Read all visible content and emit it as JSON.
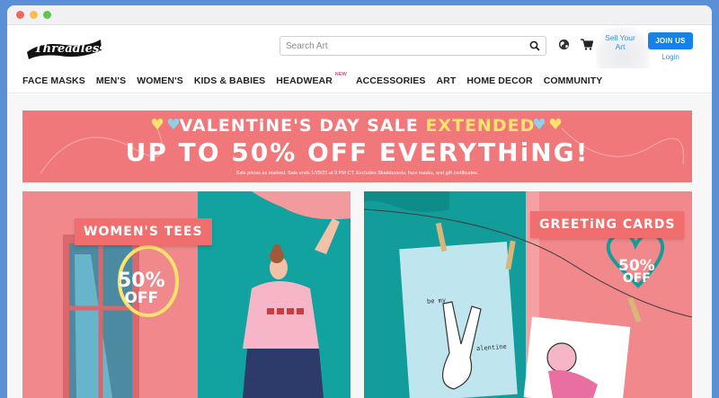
{
  "browser": {
    "controls": [
      "close",
      "minimize",
      "zoom"
    ]
  },
  "header": {
    "logo_text": "Threadless",
    "search_placeholder": "Search Art",
    "sell_label": "Sell Your Art",
    "join_label": "JOIN US",
    "login_label": "Login"
  },
  "nav": {
    "items": [
      {
        "label": "FACE MASKS"
      },
      {
        "label": "MEN'S"
      },
      {
        "label": "WOMEN'S"
      },
      {
        "label": "KIDS & BABIES"
      },
      {
        "label": "HEADWEAR",
        "badge": "NEW"
      },
      {
        "label": "ACCESSORIES"
      },
      {
        "label": "ART"
      },
      {
        "label": "HOME DECOR"
      },
      {
        "label": "COMMUNITY"
      }
    ]
  },
  "banner": {
    "headline_part1": "VALENTiNE'S DAY SALE",
    "headline_part2": "EXTENDED",
    "headline_big": "UP TO 50% OFF EVERYTHiNG!",
    "fine_print": "Sale prices as marked. Sale ends 1/29/21 at 9 PM CT. Excludes Skateboards, face masks, and gift certificates."
  },
  "promos": [
    {
      "title": "WOMEN'S TEES",
      "discount_value": "50%",
      "discount_label": "OFF"
    },
    {
      "title": "GREETiNG CARDS",
      "discount_value": "50%",
      "discount_label": "OFF",
      "card_text_top": "be my",
      "card_text_bottom": "alentine"
    }
  ],
  "colors": {
    "accent_blue": "#1782e6",
    "banner_pink": "#f0787a",
    "extended_yellow": "#fbe36c",
    "teal": "#139d9a",
    "badge_pink": "#e8448d"
  }
}
